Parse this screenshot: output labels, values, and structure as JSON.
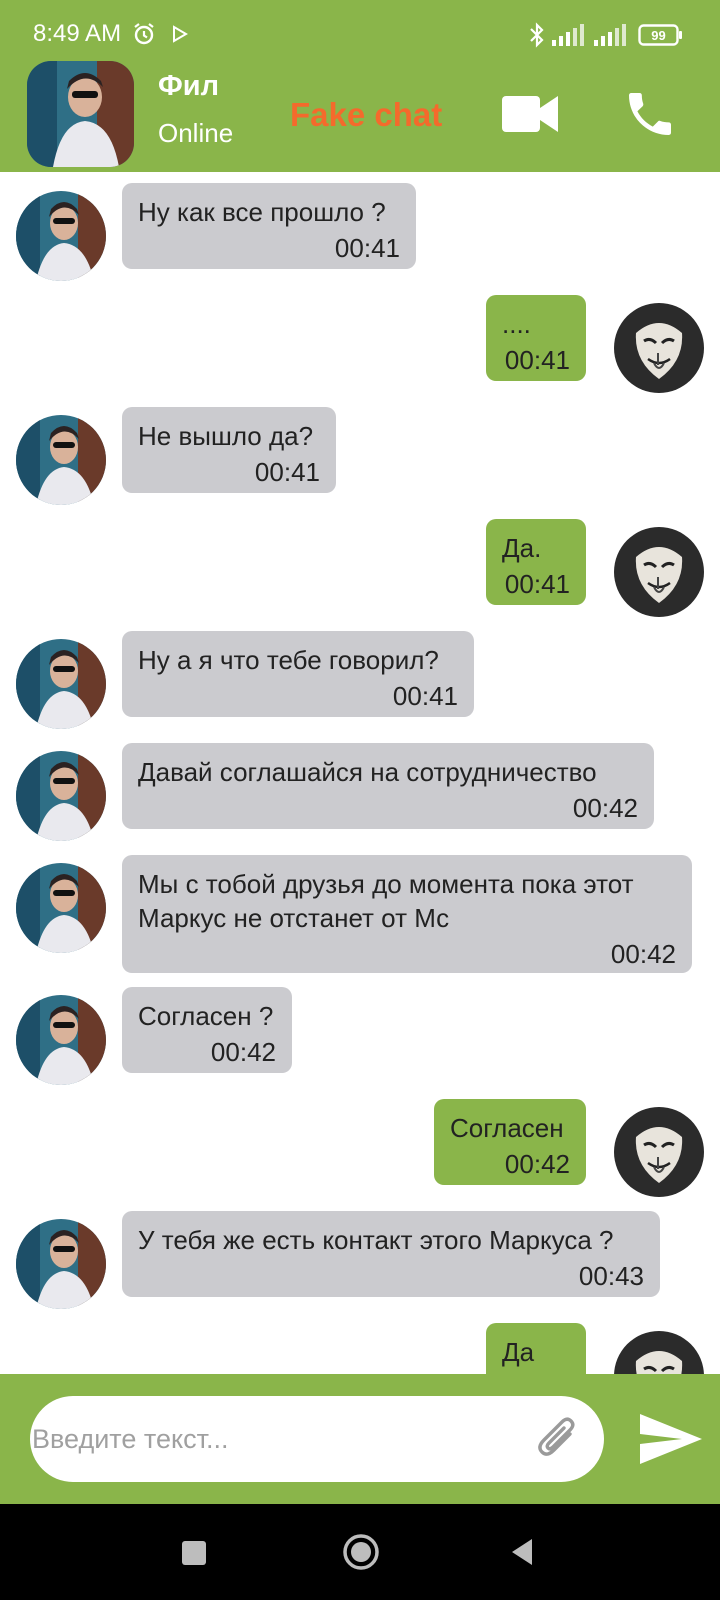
{
  "status_bar": {
    "time": "8:49 AM",
    "battery": "99"
  },
  "header": {
    "contact_name": "Фил",
    "contact_status": "Online",
    "app_title": "Fake chat"
  },
  "messages": [
    {
      "side": "in",
      "text": "Ну как все прошло ?",
      "time": "00:41"
    },
    {
      "side": "out",
      "text": "....",
      "time": "00:41"
    },
    {
      "side": "in",
      "text": "Не вышло да?",
      "time": "00:41"
    },
    {
      "side": "out",
      "text": "Да.",
      "time": "00:41"
    },
    {
      "side": "in",
      "text": "Ну а я что тебе говорил?",
      "time": "00:41"
    },
    {
      "side": "in",
      "text": "Давай соглашайся на сотрудничество",
      "time": "00:42"
    },
    {
      "side": "in",
      "text": "Мы с тобой друзья до момента пока этот\nМаркус не отстанет от Мс",
      "time": "00:42"
    },
    {
      "side": "in",
      "text": "Согласен ?",
      "time": "00:42"
    },
    {
      "side": "out",
      "text": "Согласен",
      "time": "00:42"
    },
    {
      "side": "in",
      "text": "У тебя же есть контакт этого Маркуса ?",
      "time": "00:43"
    },
    {
      "side": "out",
      "text": "Да",
      "time": ""
    }
  ],
  "input": {
    "placeholder": "Введите текст..."
  },
  "colors": {
    "theme_green": "#8ab54a",
    "incoming_bubble": "#cbcbcf",
    "title_orange": "#f46a2c"
  }
}
